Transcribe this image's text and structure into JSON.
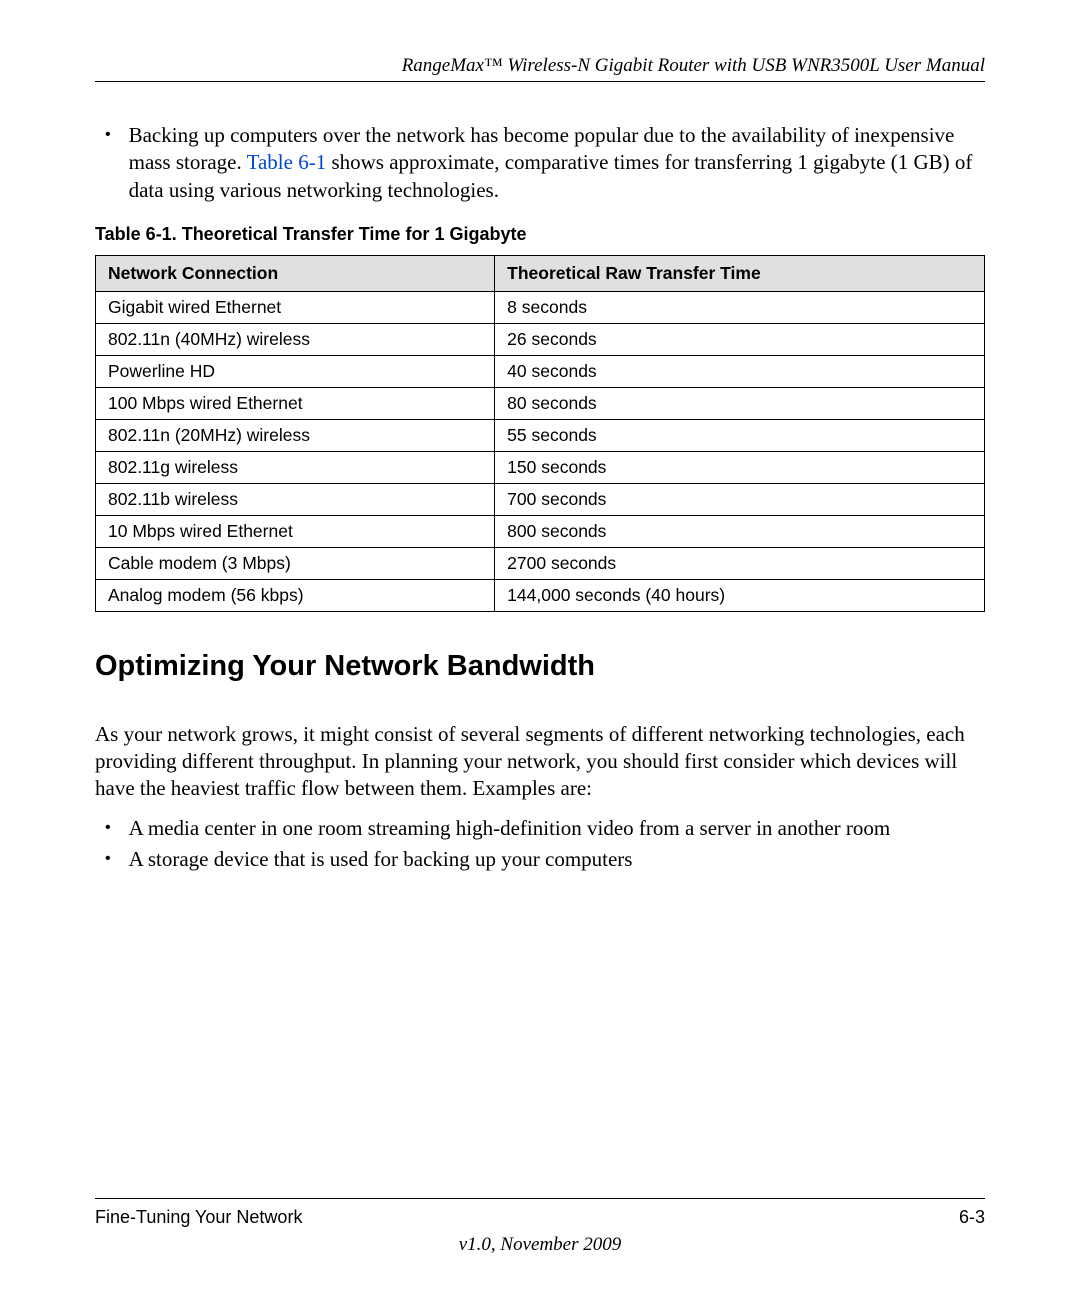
{
  "header": {
    "title": "RangeMax™ Wireless-N Gigabit Router with USB WNR3500L User Manual"
  },
  "main_bullet": {
    "text_before_link": "Backing up computers over the network has become popular due to the availability of inexpensive mass storage. ",
    "link_text": "Table 6-1",
    "text_after_link": " shows approximate, comparative times for transferring 1 gigabyte (1 GB) of data using various networking technologies."
  },
  "table_caption": "Table 6-1.  Theoretical Transfer Time for 1 Gigabyte",
  "chart_data": {
    "type": "table",
    "columns": [
      "Network Connection",
      "Theoretical Raw Transfer Time"
    ],
    "rows": [
      {
        "c0": "Gigabit wired Ethernet",
        "c1": "8 seconds"
      },
      {
        "c0": "802.11n (40MHz) wireless",
        "c1": "26 seconds"
      },
      {
        "c0": "Powerline HD",
        "c1": "40 seconds"
      },
      {
        "c0": "100 Mbps wired Ethernet",
        "c1": "80 seconds"
      },
      {
        "c0": "802.11n (20MHz) wireless",
        "c1": "55 seconds"
      },
      {
        "c0": "802.11g wireless",
        "c1": "150 seconds"
      },
      {
        "c0": "802.11b wireless",
        "c1": "700 seconds"
      },
      {
        "c0": "10 Mbps wired Ethernet",
        "c1": "800 seconds"
      },
      {
        "c0": "Cable modem (3 Mbps)",
        "c1": "2700 seconds"
      },
      {
        "c0": "Analog modem (56 kbps)",
        "c1": "144,000 seconds (40 hours)"
      }
    ]
  },
  "section_heading": "Optimizing Your Network Bandwidth",
  "section_paragraph": "As your network grows, it might consist of several segments of different networking technologies, each providing different throughput. In planning your network, you should first consider which devices will have the heaviest traffic flow between them. Examples are:",
  "sub_bullets": [
    "A media center in one room streaming high-definition video from a server in another room",
    "A storage device that is used for backing up your computers"
  ],
  "footer": {
    "left": "Fine-Tuning Your Network",
    "right": "6-3",
    "version": "v1.0, November 2009"
  }
}
